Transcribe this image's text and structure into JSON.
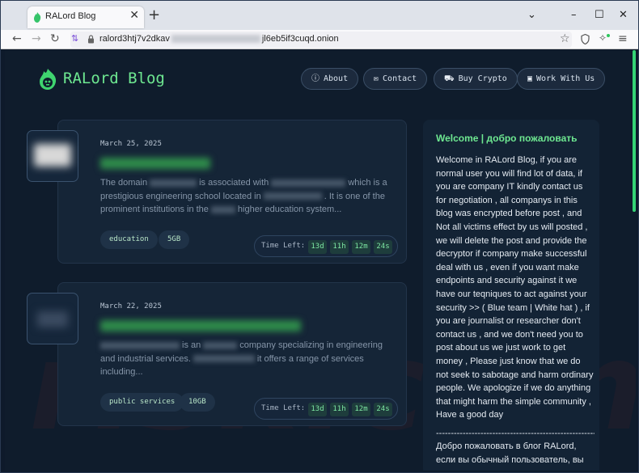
{
  "browser": {
    "tab_title": "RALord Blog",
    "tab_close": "✕",
    "new_tab": "+",
    "url_start": "ralord3htj7v2dkav",
    "url_end": "jl6eb5if3cuqd.onion",
    "window_controls": {
      "minimize": "–",
      "maximize": "☐",
      "close": "✕",
      "dropdown": "⌄"
    },
    "icons": [
      "back-icon",
      "forward-icon",
      "reload-icon",
      "tracking-icon",
      "lock-icon",
      "star-icon",
      "shield-icon",
      "sparkle-icon",
      "menu-icon"
    ]
  },
  "site": {
    "name": "RALord Blog",
    "accent": "#6ee891",
    "nav": [
      {
        "label": "About",
        "icon": "info-icon"
      },
      {
        "label": "Contact",
        "icon": "envelope-icon"
      },
      {
        "label": "Buy Crypto",
        "icon": "cart-icon"
      },
      {
        "label": "Work With Us",
        "icon": "briefcase-icon"
      }
    ]
  },
  "posts": [
    {
      "date": "March 25, 2025",
      "text_parts": [
        "The domain",
        "is associated with",
        "which",
        "is a prestigious engineering school located in",
        ". It is one of the",
        "prominent institutions in the",
        "higher education system..."
      ],
      "tags": [
        "education",
        "5GB"
      ],
      "time_label": "Time Left:",
      "time": [
        "13d",
        "11h",
        "12m",
        "24s"
      ]
    },
    {
      "date": "March 22, 2025",
      "text_parts": [
        "is an",
        "company specializing in engineering",
        "and industrial services.",
        "it offers a range of services",
        "including..."
      ],
      "tags": [
        "public services",
        "10GB"
      ],
      "time_label": "Time Left:",
      "time": [
        "13d",
        "11h",
        "12m",
        "24s"
      ]
    }
  ],
  "sidebar": {
    "title": "Welcome | добро пожаловать",
    "body": "Welcome in RALord Blog, if you are normal user you will find lot of data, if you are company IT kindly contact us for negotiation , all companys in this blog was encrypted before post , and Not all victims effect by us will posted , we will delete the post and provide the decryptor if company make successful deal with us , even if you want make endpoints and security against it we have our teqniques to act against your security >> ( Blue team | White hat ) , if you are journalist or researcher don't contact us , and we don't need you to post about us we just work to get money , Please just know that we do not seek to sabotage and harm ordinary people. We apologize if we do anything that might harm the simple community , Have a good day",
    "separator": "--------------------------------------------------------------",
    "body_ru": "Добро пожаловать в блог RALord, если вы обычный пользователь, вы"
  }
}
